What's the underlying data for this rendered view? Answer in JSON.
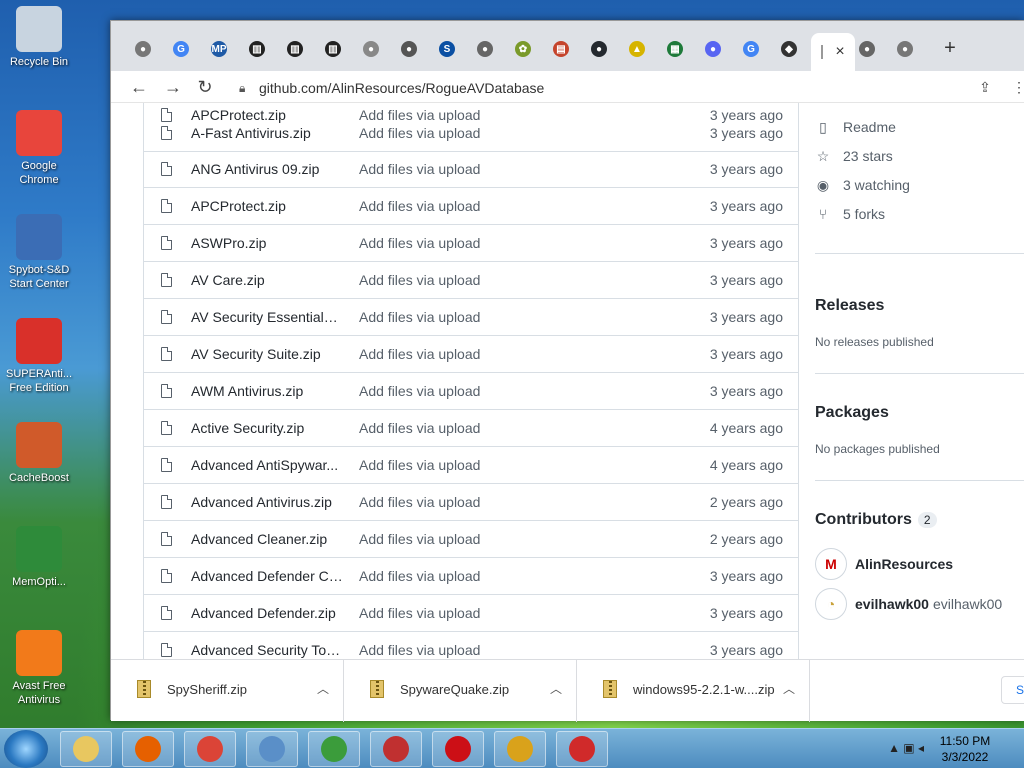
{
  "desktop": {
    "icons": [
      {
        "label": "Recycle Bin",
        "color": "#c8d4e0",
        "icon": "recycle-bin-icon"
      },
      {
        "label": "Google Chrome",
        "color": "#e8453c",
        "icon": "chrome-icon"
      },
      {
        "label": "Spybot-S&D Start Center",
        "color": "#3b6db5",
        "icon": "spybot-icon"
      },
      {
        "label": "SUPERAnti... Free Edition",
        "color": "#d9302a",
        "icon": "superantispyware-icon"
      },
      {
        "label": "CacheBoost",
        "color": "#d05a2a",
        "icon": "cacheboost-icon"
      },
      {
        "label": "MemOpti...",
        "color": "#2e8b3a",
        "icon": "memory-optimizer-icon"
      },
      {
        "label": "Avast Free Antivirus",
        "color": "#f27a1a",
        "icon": "avast-icon"
      }
    ]
  },
  "browser": {
    "tab_close": "×",
    "new_tab": "+",
    "tabs": [
      {
        "icon": "chrome-icon",
        "glyph": "●",
        "color": "#777"
      },
      {
        "icon": "google-icon",
        "glyph": "G",
        "color": "#4285f4"
      },
      {
        "icon": "mp-icon",
        "glyph": "MP",
        "color": "#1f5aa6"
      },
      {
        "icon": "building-icon",
        "glyph": "▥",
        "color": "#222"
      },
      {
        "icon": "building-icon",
        "glyph": "▥",
        "color": "#222"
      },
      {
        "icon": "building-icon",
        "glyph": "▥",
        "color": "#222"
      },
      {
        "icon": "globe-icon",
        "glyph": "●",
        "color": "#888"
      },
      {
        "icon": "globe-icon",
        "glyph": "●",
        "color": "#555"
      },
      {
        "icon": "s-icon",
        "glyph": "S",
        "color": "#0a4fa3"
      },
      {
        "icon": "globe-icon",
        "glyph": "●",
        "color": "#666"
      },
      {
        "icon": "extension-icon",
        "glyph": "✿",
        "color": "#7a9a2a"
      },
      {
        "icon": "document-icon",
        "glyph": "▤",
        "color": "#c5442c"
      },
      {
        "icon": "github-icon",
        "glyph": "●",
        "color": "#24292f"
      },
      {
        "icon": "warning-icon",
        "glyph": "▲",
        "color": "#d6b400"
      },
      {
        "icon": "spreadsheet-icon",
        "glyph": "▦",
        "color": "#1e7a3a"
      },
      {
        "icon": "discord-icon",
        "glyph": "●",
        "color": "#5865f2"
      },
      {
        "icon": "google-icon",
        "glyph": "G",
        "color": "#4285f4"
      },
      {
        "icon": "shield-icon",
        "glyph": "◆",
        "color": "#333"
      }
    ],
    "tabs_after": [
      {
        "icon": "globe-icon",
        "glyph": "●",
        "color": "#666"
      },
      {
        "icon": "chrome-icon",
        "glyph": "●",
        "color": "#777"
      }
    ],
    "url": "github.com/AlinResources/RogueAVDatabase"
  },
  "files": [
    {
      "name": "APCProtect.zip",
      "message": "Add files via upload",
      "age": "3 years ago"
    },
    {
      "name": "A-Fast Antivirus.zip",
      "message": "Add files via upload",
      "age": "3 years ago"
    },
    {
      "name": "ANG Antivirus 09.zip",
      "message": "Add files via upload",
      "age": "3 years ago"
    },
    {
      "name": "APCProtect.zip",
      "message": "Add files via upload",
      "age": "3 years ago"
    },
    {
      "name": "ASWPro.zip",
      "message": "Add files via upload",
      "age": "3 years ago"
    },
    {
      "name": "AV Care.zip",
      "message": "Add files via upload",
      "age": "3 years ago"
    },
    {
      "name": "AV Security Essentials....",
      "message": "Add files via upload",
      "age": "3 years ago"
    },
    {
      "name": "AV Security Suite.zip",
      "message": "Add files via upload",
      "age": "3 years ago"
    },
    {
      "name": "AWM Antivirus.zip",
      "message": "Add files via upload",
      "age": "3 years ago"
    },
    {
      "name": "Active Security.zip",
      "message": "Add files via upload",
      "age": "4 years ago"
    },
    {
      "name": "Advanced AntiSpywar...",
      "message": "Add files via upload",
      "age": "4 years ago"
    },
    {
      "name": "Advanced Antivirus.zip",
      "message": "Add files via upload",
      "age": "2 years ago"
    },
    {
      "name": "Advanced Cleaner.zip",
      "message": "Add files via upload",
      "age": "2 years ago"
    },
    {
      "name": "Advanced Defender Cr...",
      "message": "Add files via upload",
      "age": "3 years ago"
    },
    {
      "name": "Advanced Defender.zip",
      "message": "Add files via upload",
      "age": "3 years ago"
    },
    {
      "name": "Advanced Security Too...",
      "message": "Add files via upload",
      "age": "3 years ago"
    }
  ],
  "sidebar": {
    "readme": "Readme",
    "stars": "23 stars",
    "watching": "3 watching",
    "forks": "5 forks",
    "releases_title": "Releases",
    "releases_note": "No releases published",
    "packages_title": "Packages",
    "packages_note": "No packages published",
    "contributors_title": "Contributors",
    "contributors_count": "2",
    "contributors": [
      {
        "name": "AlinResources",
        "login": "",
        "avatar": "M"
      },
      {
        "name": "evilhawk00",
        "login": "evilhawk00",
        "avatar": "◔"
      }
    ]
  },
  "downloads": {
    "items": [
      "SpySheriff.zip",
      "SpywareQuake.zip",
      "windows95-2.2.1-w....zip"
    ],
    "show_all": "Sh"
  },
  "taskbar": {
    "time": "11:50 PM",
    "date": "3/3/2022"
  }
}
